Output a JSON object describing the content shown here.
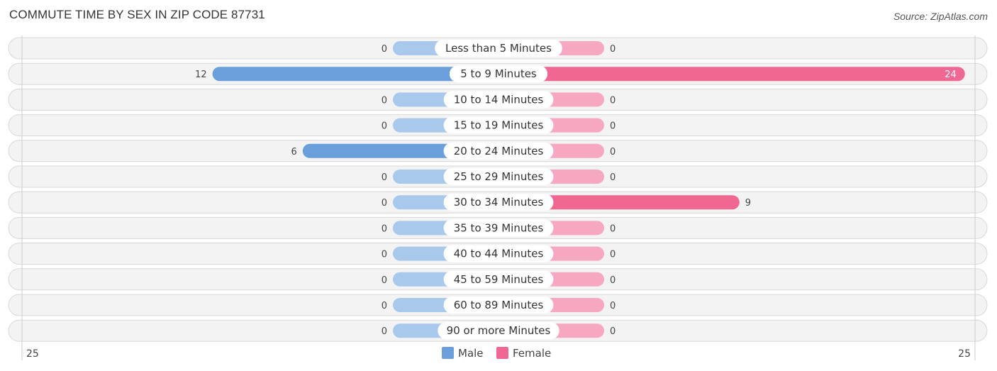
{
  "header": {
    "title": "COMMUTE TIME BY SEX IN ZIP CODE 87731",
    "source": "Source: ZipAtlas.com"
  },
  "chart_data": {
    "type": "bar",
    "orientation": "horizontal-diverging",
    "title": "COMMUTE TIME BY SEX IN ZIP CODE 87731",
    "categories": [
      "Less than 5 Minutes",
      "5 to 9 Minutes",
      "10 to 14 Minutes",
      "15 to 19 Minutes",
      "20 to 24 Minutes",
      "25 to 29 Minutes",
      "30 to 34 Minutes",
      "35 to 39 Minutes",
      "40 to 44 Minutes",
      "45 to 59 Minutes",
      "60 to 89 Minutes",
      "90 or more Minutes"
    ],
    "series": [
      {
        "name": "Male",
        "color": "#6a9fdc",
        "light_color": "#a8c8ec",
        "values": [
          0,
          12,
          0,
          0,
          6,
          0,
          0,
          0,
          0,
          0,
          0,
          0
        ]
      },
      {
        "name": "Female",
        "color": "#f06892",
        "light_color": "#f7a8c1",
        "values": [
          0,
          24,
          0,
          0,
          0,
          0,
          9,
          0,
          0,
          0,
          0,
          0
        ]
      }
    ],
    "axis": {
      "left_label": "25",
      "right_label": "25",
      "max": 25
    },
    "legend": {
      "placement": "bottom-center",
      "entries": [
        "Male",
        "Female"
      ]
    }
  }
}
